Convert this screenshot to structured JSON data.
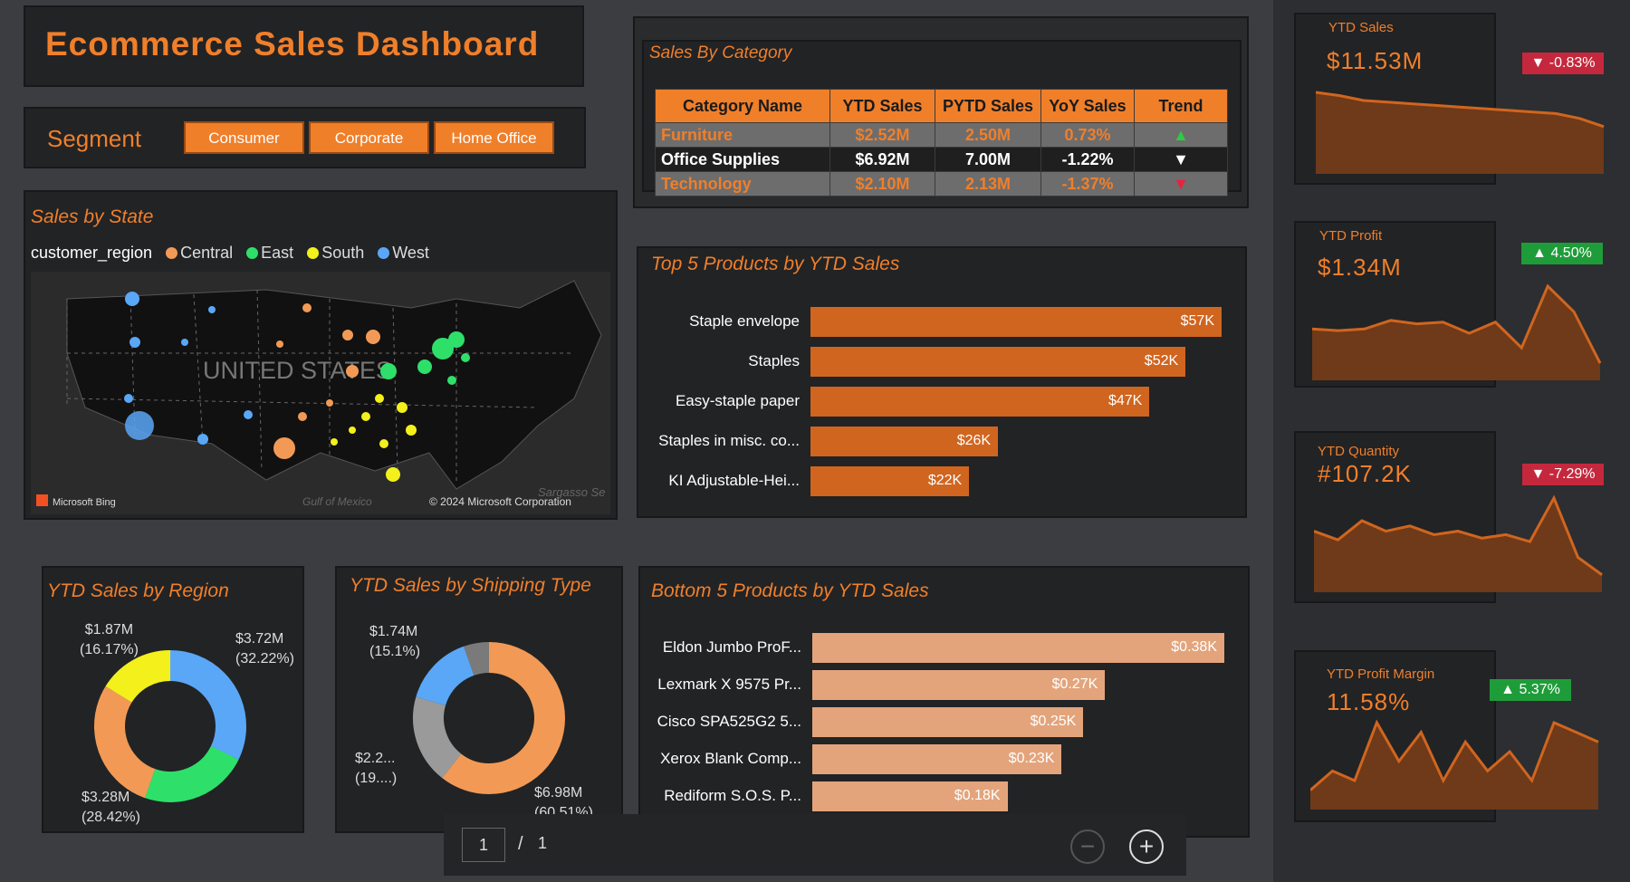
{
  "dashboard": {
    "title": "Ecommerce Sales Dashboard"
  },
  "segment": {
    "label": "Segment",
    "buttons": [
      "Consumer",
      "Corporate",
      "Home Office"
    ]
  },
  "category_table": {
    "title": "Sales By Category",
    "headers": [
      "Category Name",
      "YTD Sales",
      "PYTD Sales",
      "YoY Sales",
      "Trend"
    ],
    "rows": [
      {
        "name": "Furniture",
        "ytd": "$2.52M",
        "pytd": "2.50M",
        "yoy": "0.73%",
        "trend": "▲"
      },
      {
        "name": "Office Supplies",
        "ytd": "$6.92M",
        "pytd": "7.00M",
        "yoy": "-1.22%",
        "trend": "▼"
      },
      {
        "name": "Technology",
        "ytd": "$2.10M",
        "pytd": "2.13M",
        "yoy": "-1.37%",
        "trend": "▼"
      }
    ]
  },
  "map": {
    "title": "Sales by State",
    "legend_field": "customer_region",
    "legend": [
      {
        "name": "Central",
        "color": "#f29a55"
      },
      {
        "name": "East",
        "color": "#2ee06a"
      },
      {
        "name": "South",
        "color": "#f3f01b"
      },
      {
        "name": "West",
        "color": "#5aa7f7"
      }
    ],
    "country_label": "UNITED STATES",
    "bing": "Microsoft Bing",
    "copyright": "© 2024 Microsoft Corporation",
    "gulf": "Gulf of Mexico",
    "sargasso": "Sargasso Se"
  },
  "top5": {
    "title": "Top 5 Products by YTD Sales",
    "color": "#d0651f",
    "items": [
      {
        "label": "Staple envelope",
        "value": 57,
        "display": "$57K"
      },
      {
        "label": "Staples",
        "value": 52,
        "display": "$52K"
      },
      {
        "label": "Easy-staple paper",
        "value": 47,
        "display": "$47K"
      },
      {
        "label": "Staples in misc. co...",
        "value": 26,
        "display": "$26K"
      },
      {
        "label": "KI Adjustable-Hei...",
        "value": 22,
        "display": "$22K"
      }
    ]
  },
  "bottom5": {
    "title": "Bottom 5 Products by YTD Sales",
    "color": "#e3a47c",
    "items": [
      {
        "label": "Eldon Jumbo ProF...",
        "value": 0.38,
        "display": "$0.38K"
      },
      {
        "label": "Lexmark X 9575 Pr...",
        "value": 0.27,
        "display": "$0.27K"
      },
      {
        "label": "Cisco SPA525G2 5...",
        "value": 0.25,
        "display": "$0.25K"
      },
      {
        "label": "Xerox Blank Comp...",
        "value": 0.23,
        "display": "$0.23K"
      },
      {
        "label": "Rediform S.O.S. P...",
        "value": 0.18,
        "display": "$0.18K"
      }
    ]
  },
  "region_donut": {
    "title": "YTD Sales by Region",
    "labels": [
      {
        "value": "$1.87M",
        "pct": "(16.17%)"
      },
      {
        "value": "$3.72M",
        "pct": "(32.22%)"
      },
      {
        "value": "$3.28M",
        "pct": "(28.42%)"
      }
    ]
  },
  "shipping_donut": {
    "title": "YTD Sales by Shipping Type",
    "labels": [
      {
        "value": "$1.74M",
        "pct": "(15.1%)"
      },
      {
        "value": "$2.2...",
        "pct": "(19....)"
      },
      {
        "value": "$6.98M",
        "pct": "(60.51%)"
      }
    ]
  },
  "kpis": [
    {
      "label": "YTD Sales",
      "value": "$11.53M",
      "badge": "▼ -0.83%",
      "direction": "down"
    },
    {
      "label": "YTD Profit",
      "value": "$1.34M",
      "badge": "▲ 4.50%",
      "direction": "up"
    },
    {
      "label": "YTD Quantity",
      "value": "#107.2K",
      "badge": "▼ -7.29%",
      "direction": "down"
    },
    {
      "label": "YTD Profit Margin",
      "value": "11.58%",
      "badge": "▲ 5.37%",
      "direction": "up"
    }
  ],
  "pager": {
    "current": "1",
    "sep": "/",
    "total": "1"
  },
  "chart_data": [
    {
      "type": "bar",
      "title": "Top 5 Products by YTD Sales",
      "categories": [
        "Staple envelope",
        "Staples",
        "Easy-staple paper",
        "Staples in misc. co...",
        "KI Adjustable-Hei..."
      ],
      "values": [
        57,
        52,
        47,
        26,
        22
      ],
      "unit": "$K"
    },
    {
      "type": "bar",
      "title": "Bottom 5 Products by YTD Sales",
      "categories": [
        "Eldon Jumbo ProF...",
        "Lexmark X 9575 Pr...",
        "Cisco SPA525G2 5...",
        "Xerox Blank Comp...",
        "Rediform S.O.S. P..."
      ],
      "values": [
        0.38,
        0.27,
        0.25,
        0.23,
        0.18
      ],
      "unit": "$K"
    },
    {
      "type": "pie",
      "title": "YTD Sales by Region",
      "slices": [
        {
          "name": "Central",
          "value": 3.28,
          "pct": 28.42,
          "color": "#f29a55"
        },
        {
          "name": "East",
          "value": 2.66,
          "pct": 23.19,
          "color": "#2ee06a"
        },
        {
          "name": "South",
          "value": 1.87,
          "pct": 16.17,
          "color": "#f3f01b"
        },
        {
          "name": "West",
          "value": 3.72,
          "pct": 32.22,
          "color": "#5aa7f7"
        }
      ]
    },
    {
      "type": "pie",
      "title": "YTD Sales by Shipping Type",
      "slices": [
        {
          "value": 6.98,
          "pct": 60.51,
          "color": "#f29a55"
        },
        {
          "value": 2.2,
          "pct": 19.0,
          "color": "#9a9a9a"
        },
        {
          "value": 1.74,
          "pct": 15.1,
          "color": "#5aa7f7"
        },
        {
          "value": 0.62,
          "pct": 5.39,
          "color": "#7a7a7a"
        }
      ]
    },
    {
      "type": "area",
      "title": "YTD Sales",
      "values": [
        100,
        96,
        90,
        88,
        86,
        84,
        82,
        80,
        78,
        76,
        74,
        68,
        58
      ],
      "color": "#d0651f"
    },
    {
      "type": "area",
      "title": "YTD Profit",
      "values": [
        60,
        58,
        60,
        70,
        66,
        68,
        55,
        68,
        38,
        110,
        80,
        20
      ],
      "color": "#d0651f"
    },
    {
      "type": "area",
      "title": "YTD Quantity",
      "values": [
        70,
        60,
        82,
        70,
        76,
        66,
        70,
        62,
        66,
        58,
        108,
        40,
        20
      ],
      "color": "#d0651f"
    },
    {
      "type": "area",
      "title": "YTD Profit Margin",
      "values": [
        20,
        40,
        30,
        90,
        50,
        80,
        30,
        70,
        40,
        60,
        30,
        90,
        80,
        70
      ],
      "color": "#d0651f"
    }
  ]
}
